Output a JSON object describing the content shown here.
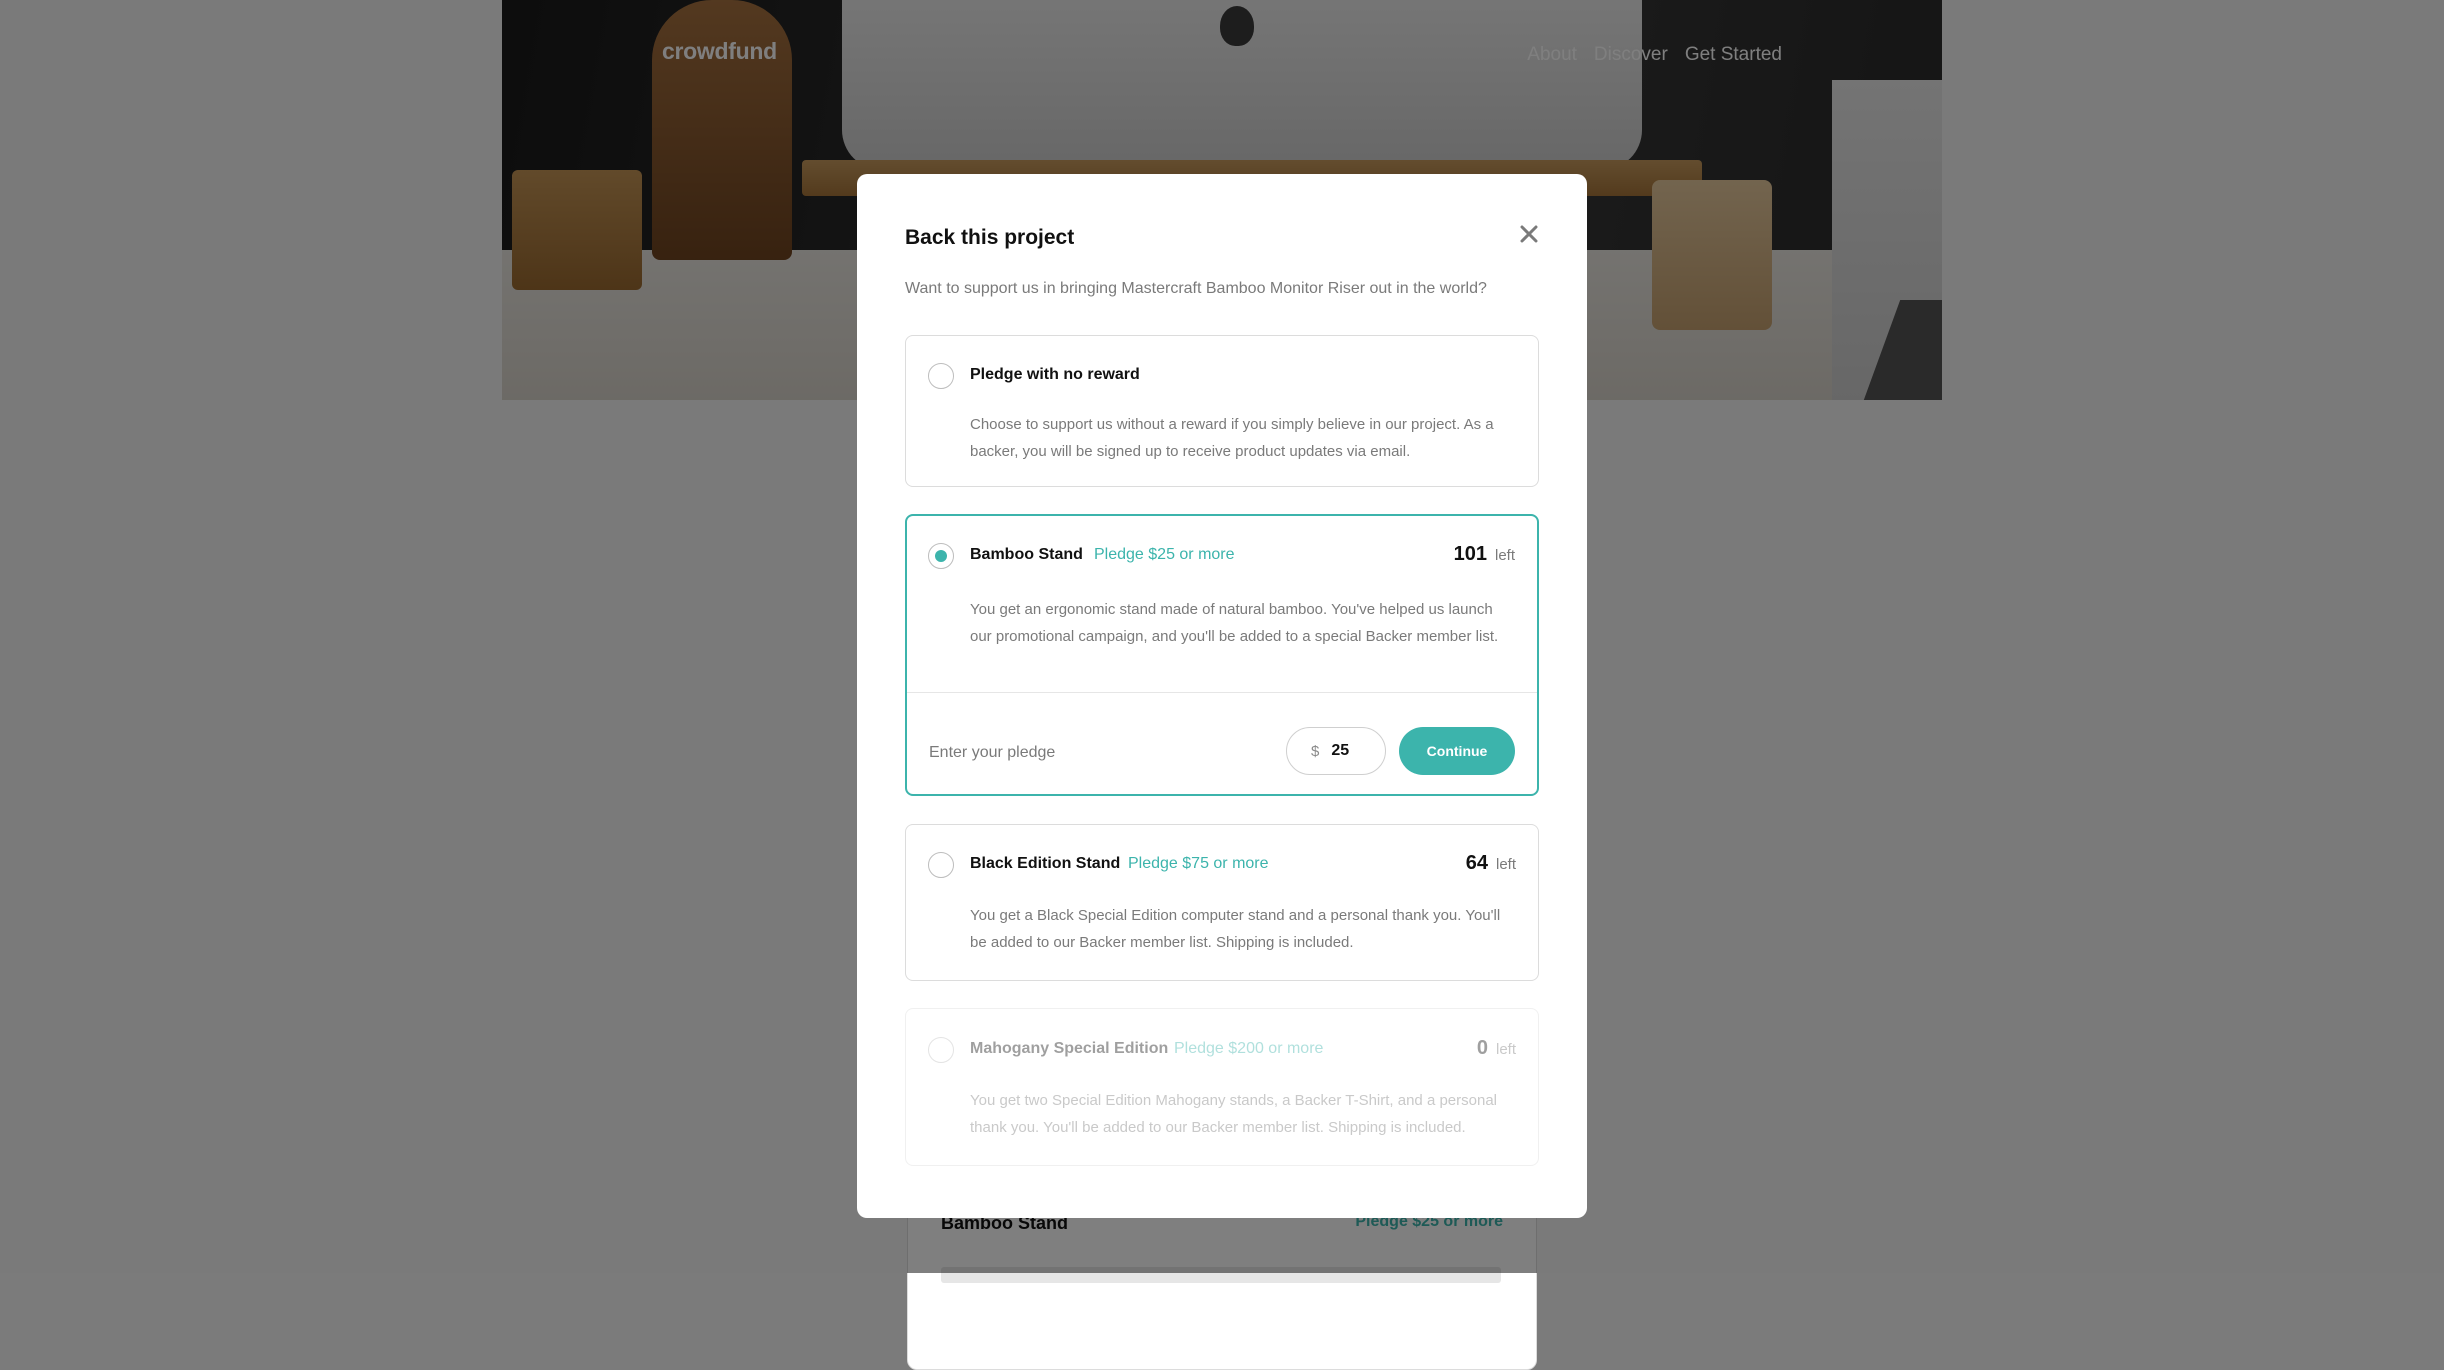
{
  "nav": {
    "logo": "crowdfund",
    "links": [
      "About",
      "Discover",
      "Get Started"
    ]
  },
  "background_card": {
    "title": "Bamboo Stand",
    "pledge": "Pledge $25 or more"
  },
  "modal": {
    "title": "Back this project",
    "subtitle": "Want to support us in bringing Mastercraft Bamboo Monitor Riser out in the world?",
    "close_icon": "close-icon",
    "options": [
      {
        "name": "Pledge with no reward",
        "pledge": "",
        "left_count": "",
        "left_label": "",
        "description": "Choose to support us without a reward if you simply believe in our project. As a backer, you will be signed up to receive product updates via email.",
        "selected": false,
        "disabled": false
      },
      {
        "name": "Bamboo Stand",
        "pledge": "Pledge $25 or more",
        "left_count": "101",
        "left_label": "left",
        "description": "You get an ergonomic stand made of natural bamboo. You've helped us launch our promotional campaign, and you'll be added to a special Backer member list.",
        "selected": true,
        "disabled": false,
        "pledge_entry": {
          "label": "Enter your pledge",
          "currency": "$",
          "value": "25",
          "button": "Continue"
        }
      },
      {
        "name": "Black Edition Stand",
        "pledge": "Pledge $75 or more",
        "left_count": "64",
        "left_label": "left",
        "description": "You get a Black Special Edition computer stand and a personal thank you. You'll be added to our Backer member list. Shipping is included.",
        "selected": false,
        "disabled": false
      },
      {
        "name": "Mahogany Special Edition",
        "pledge": "Pledge $200 or more",
        "left_count": "0",
        "left_label": "left",
        "description": "You get two Special Edition Mahogany stands, a Backer T-Shirt, and a personal thank you. You'll be added to our Backer member list. Shipping is included.",
        "selected": false,
        "disabled": true
      }
    ]
  },
  "colors": {
    "accent": "#3cb4ac",
    "text_dark": "#111111",
    "text_muted": "#7a7a7a",
    "overlay": "rgba(0,0,0,0.5)"
  }
}
